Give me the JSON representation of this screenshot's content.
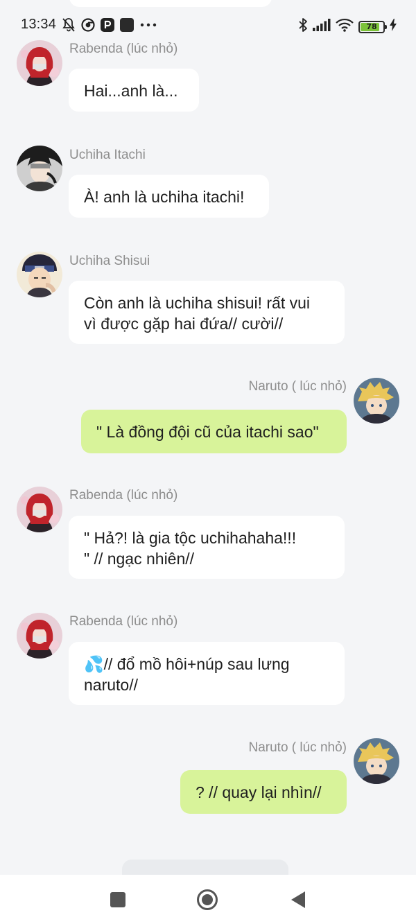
{
  "status_bar": {
    "time": "13:34",
    "battery": "78",
    "icons": [
      "mute-bell-icon",
      "chrome-icon",
      "p-app-icon",
      "square-app-icon",
      "more-dots-icon",
      "bluetooth-icon",
      "signal-icon",
      "wifi-icon",
      "battery-icon",
      "charging-icon"
    ]
  },
  "colors": {
    "background": "#f4f5f7",
    "bubble_other": "#ffffff",
    "bubble_mine": "#d8f39a",
    "sender_name": "#8d8d8d",
    "battery_fill": "#7cc33a"
  },
  "messages": [
    {
      "sender": "Rabenda (lúc nhỏ)",
      "side": "left",
      "avatar": "rabenda-avatar",
      "text": "Hai...anh là..."
    },
    {
      "sender": "Uchiha Itachi",
      "side": "left",
      "avatar": "itachi-avatar",
      "text": "À! anh là uchiha itachi!"
    },
    {
      "sender": "Uchiha Shisui",
      "side": "left",
      "avatar": "shisui-avatar",
      "text_lines": [
        "Còn anh là uchiha shisui! rất vui",
        "vì được gặp hai đứa// cười//"
      ]
    },
    {
      "sender": "Naruto ( lúc nhỏ)",
      "side": "right",
      "avatar": "naruto-avatar",
      "text": "\" Là đồng đội cũ của itachi sao\""
    },
    {
      "sender": "Rabenda (lúc nhỏ)",
      "side": "left",
      "avatar": "rabenda-avatar",
      "text_lines": [
        "\" Hả?! là gia tộc uchihahaha!!!",
        "\" // ngạc nhiên//"
      ]
    },
    {
      "sender": "Rabenda (lúc nhỏ)",
      "side": "left",
      "avatar": "rabenda-avatar",
      "text_lines": [
        "💦// đổ mồ hôi+núp sau lưng",
        "naruto//"
      ]
    },
    {
      "sender": "Naruto ( lúc nhỏ)",
      "side": "right",
      "avatar": "naruto-avatar",
      "text": "? // quay lại nhìn//"
    }
  ],
  "nav_bar": {
    "buttons": [
      "recents-square-icon",
      "home-circle-icon",
      "back-triangle-icon"
    ]
  }
}
